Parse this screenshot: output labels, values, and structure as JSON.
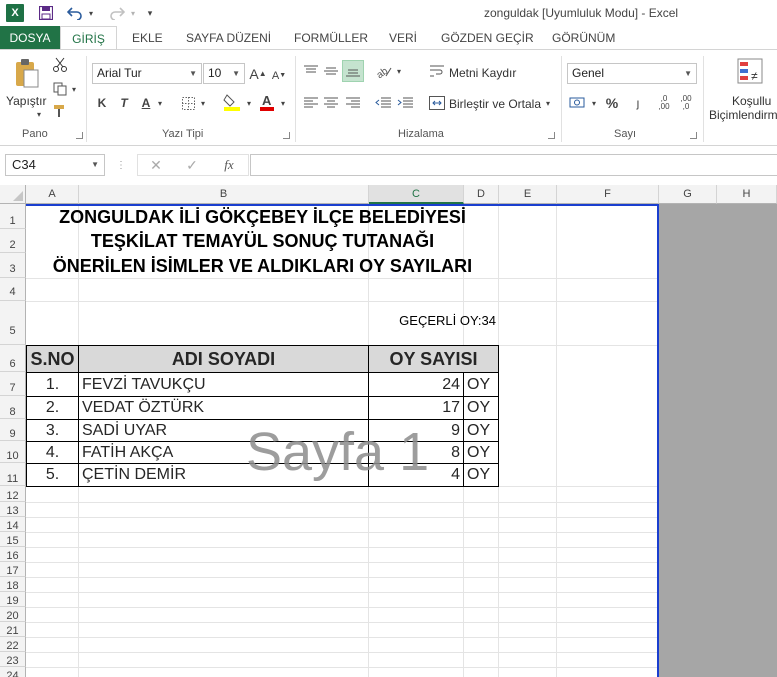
{
  "window": {
    "title": "zonguldak  [Uyumluluk Modu] - Excel",
    "app_icon": "excel-icon"
  },
  "quick_access": {
    "icons": [
      "save-icon",
      "undo-icon",
      "redo-icon",
      "customize-icon"
    ]
  },
  "ribbon": {
    "tabs": [
      "DOSYA",
      "GİRİŞ",
      "EKLE",
      "SAYFA DÜZENİ",
      "FORMÜLLER",
      "VERİ",
      "GÖZDEN GEÇİR",
      "GÖRÜNÜM"
    ],
    "active_tab": "GİRİŞ",
    "clipboard": {
      "paste_label": "Yapıştır",
      "group_label": "Pano"
    },
    "font": {
      "font_name": "Arial Tur",
      "font_size": "10",
      "group_label": "Yazı Tipi",
      "bold": "K",
      "italic": "T",
      "underline": "A"
    },
    "alignment": {
      "wrap_label": "Metni Kaydır",
      "merge_label": "Birleştir ve Ortala",
      "group_label": "Hizalama"
    },
    "number": {
      "format": "Genel",
      "percent": "%",
      "group_label": "Sayı"
    },
    "styles": {
      "conditional_line1": "Koşullu",
      "conditional_line2": "Biçimlendirme"
    },
    "colors": {
      "accent": "#217346",
      "fill_yellow": "#ffff00",
      "font_red": "#e00000"
    }
  },
  "formula_bar": {
    "name_box": "C34",
    "fx": "fx",
    "formula": ""
  },
  "sheet": {
    "columns": [
      "A",
      "B",
      "C",
      "D",
      "E",
      "F",
      "G",
      "H"
    ],
    "selected_column": "C",
    "rows": [
      "1",
      "2",
      "3",
      "4",
      "5",
      "6",
      "7",
      "8",
      "9",
      "10",
      "11",
      "12",
      "13",
      "14",
      "15",
      "16",
      "17",
      "18",
      "19",
      "20",
      "21",
      "22",
      "23",
      "24"
    ],
    "titles": [
      "ZONGULDAK İLİ GÖKÇEBEY İLÇE BELEDİYESİ",
      "TEŞKİLAT TEMAYÜL SONUÇ TUTANAĞI",
      "ÖNERİLEN İSİMLER VE ALDIKLARI OY SAYILARI"
    ],
    "valid_votes": "GEÇERLİ OY:34",
    "table": {
      "headers": [
        "S.NO",
        "ADI SOYADI",
        "OY SAYISI"
      ],
      "rows": [
        {
          "no": "1.",
          "name": "FEVZİ TAVUKÇU",
          "votes": "24",
          "unit": "OY"
        },
        {
          "no": "2.",
          "name": "VEDAT ÖZTÜRK",
          "votes": "17",
          "unit": "OY"
        },
        {
          "no": "3.",
          "name": "SADİ UYAR",
          "votes": "9",
          "unit": "OY"
        },
        {
          "no": "4.",
          "name": "FATİH AKÇA",
          "votes": "8",
          "unit": "OY"
        },
        {
          "no": "5.",
          "name": "ÇETİN DEMİR",
          "votes": "4",
          "unit": "OY"
        }
      ]
    },
    "watermark": "Sayfa 1"
  }
}
